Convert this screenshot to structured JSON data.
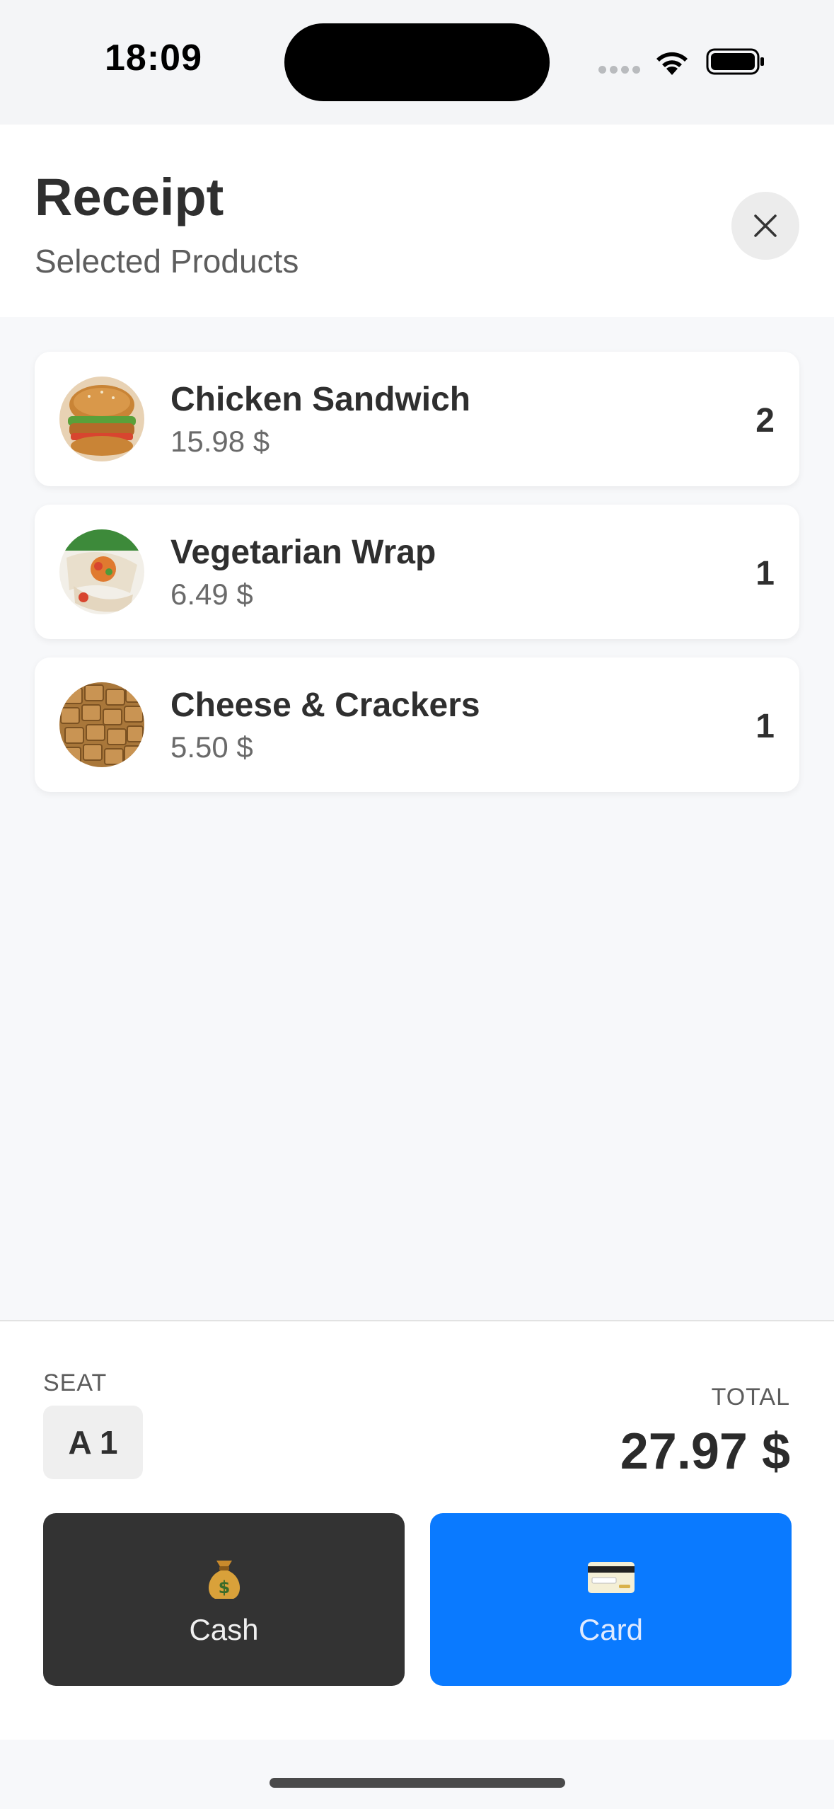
{
  "status_bar": {
    "time": "18:09"
  },
  "header": {
    "title": "Receipt",
    "subtitle": "Selected Products",
    "close_icon": "close-icon"
  },
  "items": [
    {
      "name": "Chicken Sandwich",
      "price": "15.98 $",
      "quantity": "2",
      "image": "chicken-sandwich-photo"
    },
    {
      "name": "Vegetarian Wrap",
      "price": "6.49 $",
      "quantity": "1",
      "image": "vegetarian-wrap-photo"
    },
    {
      "name": "Cheese & Crackers",
      "price": "5.50 $",
      "quantity": "1",
      "image": "cheese-crackers-photo"
    }
  ],
  "footer": {
    "seat_label": "SEAT",
    "seat_value": "A 1",
    "total_label": "TOTAL",
    "total_value": "27.97 $",
    "cash_label": "Cash",
    "cash_icon": "money-bag-icon",
    "card_label": "Card",
    "card_icon": "credit-card-icon"
  },
  "colors": {
    "accent": "#0a7aff",
    "dark_button": "#333333",
    "background": "#f7f8fa"
  }
}
